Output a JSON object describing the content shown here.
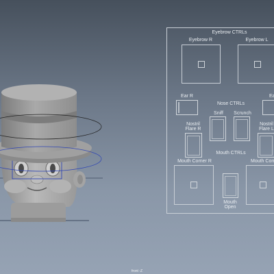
{
  "viewport": {
    "camera_label": "front -Z"
  },
  "panel": {
    "eyebrow_title": "Eyebrow CTRLs",
    "eyebrow_r": "Eyebrow R",
    "eyebrow_l": "Eyebrow L",
    "ear_r": "Ear R",
    "ear_l": "Ea",
    "nose_title": "Nose CTRLs",
    "sniff": "Sniff",
    "scrunch": "Scrunch",
    "nostril_flare_r_1": "Nostril",
    "nostril_flare_r_2": "Flare R",
    "nostril_flare_l_1": "Nostril",
    "nostril_flare_l_2": "Flare L",
    "mouth_title": "Mouth CTRLs",
    "mouth_corner_r": "Mouth Corner R",
    "mouth_corner_l": "Mouth Corn",
    "mouth_open_1": "Mouth",
    "mouth_open_2": "Open"
  }
}
